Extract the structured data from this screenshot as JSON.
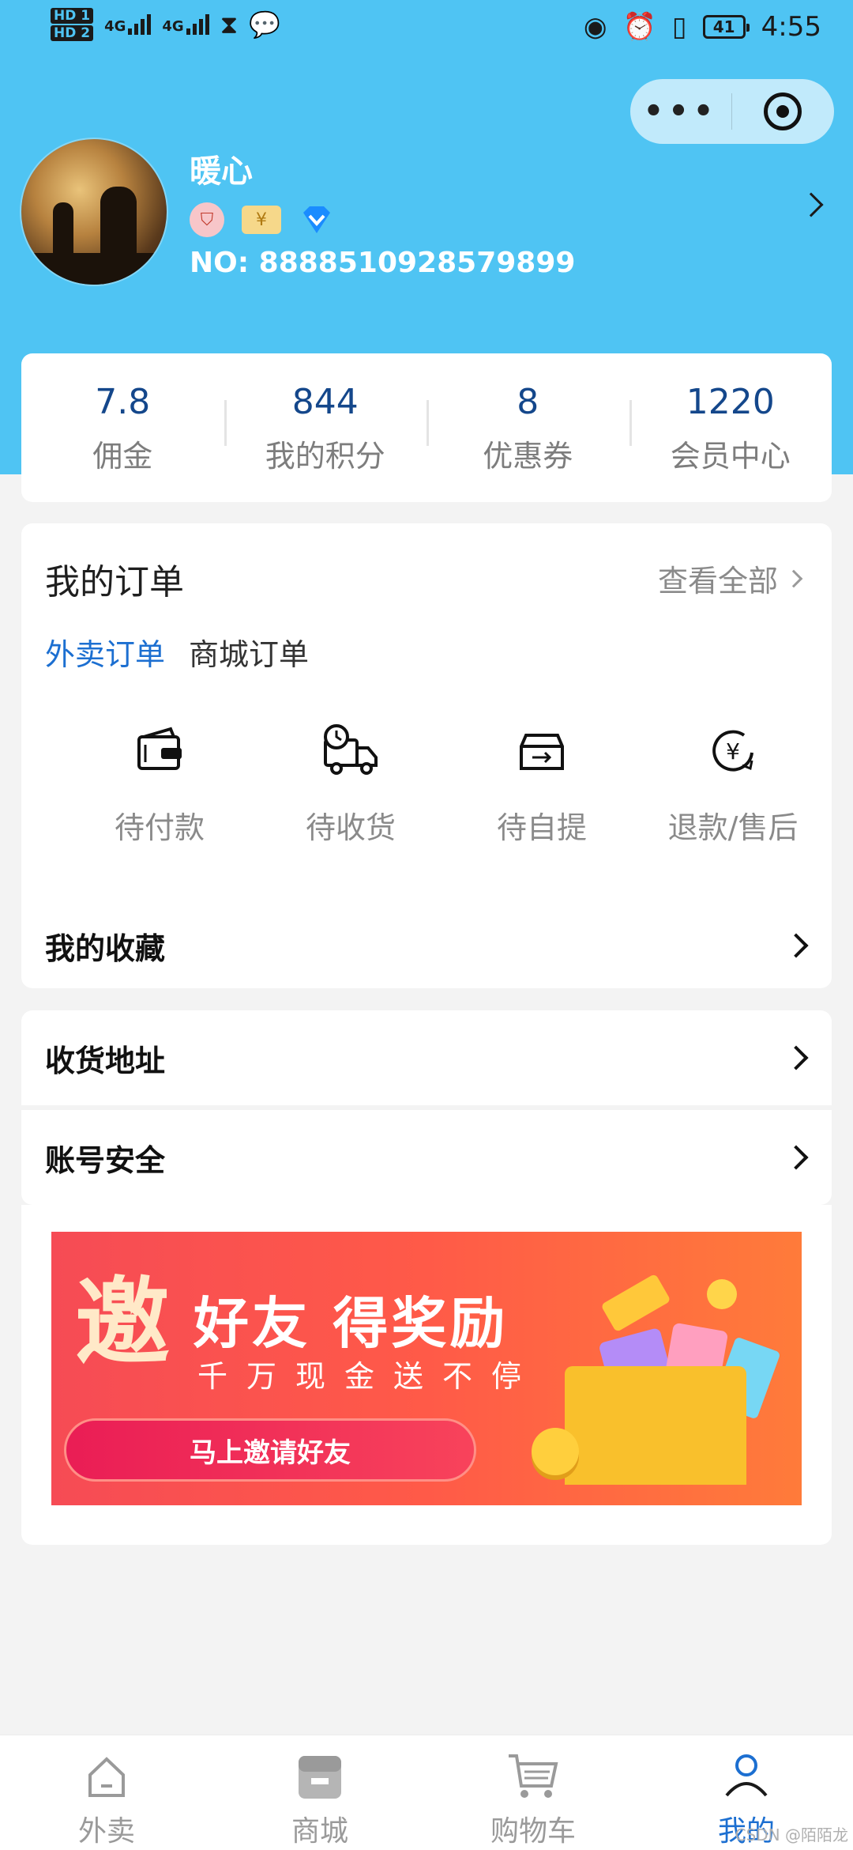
{
  "status_bar": {
    "hd1": "HD 1",
    "hd2": "HD 2",
    "network1": "4G",
    "network2": "4G",
    "battery": "41",
    "time": "4:55"
  },
  "user": {
    "name": "暖心",
    "member_no": "NO:  8888510928579899"
  },
  "stats": [
    {
      "value": "7.8",
      "label": "佣金"
    },
    {
      "value": "844",
      "label": "我的积分"
    },
    {
      "value": "8",
      "label": "优惠券"
    },
    {
      "value": "1220",
      "label": "会员中心"
    }
  ],
  "orders": {
    "title": "我的订单",
    "view_all": "查看全部",
    "tabs": [
      {
        "label": "外卖订单",
        "active": true
      },
      {
        "label": "商城订单",
        "active": false
      }
    ],
    "statuses": [
      {
        "label": "待付款",
        "icon": "wallet-icon"
      },
      {
        "label": "待收货",
        "icon": "delivery-truck-icon"
      },
      {
        "label": "待自提",
        "icon": "pickup-box-icon"
      },
      {
        "label": "退款/售后",
        "icon": "refund-yen-icon"
      }
    ]
  },
  "favorites": {
    "label": "我的收藏"
  },
  "settings": [
    {
      "label": "收货地址"
    },
    {
      "label": "账号安全"
    }
  ],
  "banner": {
    "big_char": "邀",
    "headline": "好友 得奖励",
    "subline": "千万现金送不停",
    "button": "马上邀请好友"
  },
  "tabbar": [
    {
      "label": "外卖",
      "icon": "home-icon",
      "active": false
    },
    {
      "label": "商城",
      "icon": "store-icon",
      "active": false
    },
    {
      "label": "购物车",
      "icon": "cart-icon",
      "active": false
    },
    {
      "label": "我的",
      "icon": "user-icon",
      "active": true
    }
  ],
  "watermark": "CSDN @陌陌龙",
  "colors": {
    "header_bg": "#4fc4f3",
    "accent": "#1c6fd1",
    "stat_value": "#14478b"
  }
}
